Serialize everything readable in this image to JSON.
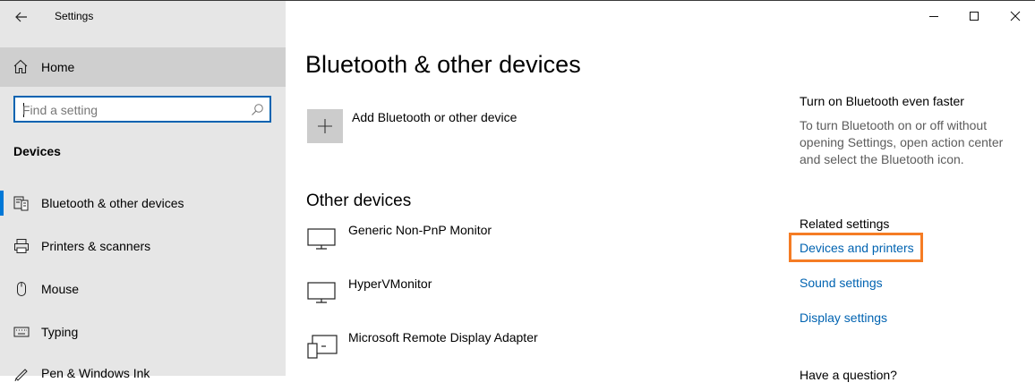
{
  "window": {
    "title": "Settings",
    "controls": {
      "minimize": "minimize-icon",
      "maximize": "maximize-icon",
      "close": "close-icon"
    }
  },
  "sidebar": {
    "home_label": "Home",
    "search": {
      "placeholder": "Find a setting",
      "value": ""
    },
    "section_label": "Devices",
    "items": [
      {
        "label": "Bluetooth & other devices",
        "icon": "bluetooth-devices-icon",
        "active": true
      },
      {
        "label": "Printers & scanners",
        "icon": "printer-icon",
        "active": false
      },
      {
        "label": "Mouse",
        "icon": "mouse-icon",
        "active": false
      },
      {
        "label": "Typing",
        "icon": "keyboard-icon",
        "active": false
      },
      {
        "label": "Pen & Windows Ink",
        "icon": "pen-icon",
        "active": false
      }
    ]
  },
  "main": {
    "title": "Bluetooth & other devices",
    "add_device_label": "Add Bluetooth or other device",
    "other_devices": {
      "heading": "Other devices",
      "items": [
        {
          "label": "Generic Non-PnP Monitor",
          "icon": "monitor-icon"
        },
        {
          "label": "HyperVMonitor",
          "icon": "monitor-icon"
        },
        {
          "label": "Microsoft Remote Display Adapter",
          "icon": "remote-display-icon"
        }
      ]
    }
  },
  "right_panel": {
    "tip_title": "Turn on Bluetooth even faster",
    "tip_text": "To turn Bluetooth on or off without opening Settings, open action center and select the Bluetooth icon.",
    "related_heading": "Related settings",
    "links": [
      "Devices and printers",
      "Sound settings",
      "Display settings"
    ],
    "question_heading": "Have a question?"
  },
  "colors": {
    "accent": "#0078d7",
    "link": "#0063b1",
    "highlight": "#f57c24",
    "sidebar_bg": "#e6e6e6"
  }
}
